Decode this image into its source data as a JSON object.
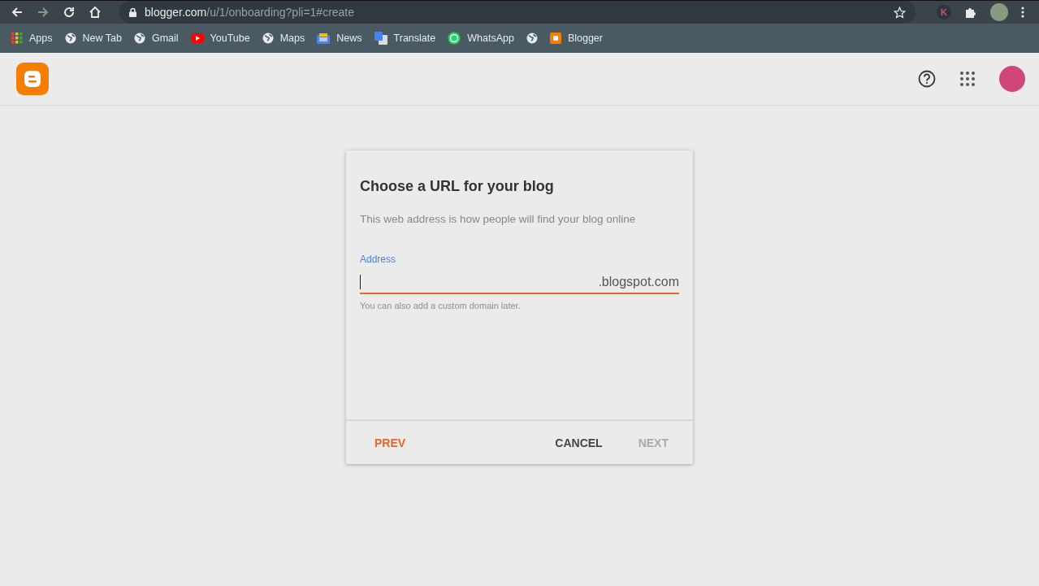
{
  "browser": {
    "url_host": "blogger.com",
    "url_path": "/u/1/onboarding?pli=1#create",
    "extension_letter": "K",
    "bookmarks": [
      {
        "kind": "apps",
        "label": "Apps"
      },
      {
        "kind": "globe",
        "label": "New Tab"
      },
      {
        "kind": "globe",
        "label": "Gmail"
      },
      {
        "kind": "youtube",
        "label": "YouTube"
      },
      {
        "kind": "globe",
        "label": "Maps"
      },
      {
        "kind": "news",
        "label": "News"
      },
      {
        "kind": "translate",
        "label": "Translate"
      },
      {
        "kind": "whatsapp",
        "label": "WhatsApp"
      },
      {
        "kind": "globe"
      },
      {
        "kind": "blogger",
        "label": "Blogger"
      }
    ]
  },
  "dialog": {
    "title": "Choose a URL for your blog",
    "subtitle": "This web address is how people will find your blog online",
    "field": {
      "label": "Address",
      "suffix": ".blogspot.com",
      "helper": "You can also add a custom domain later.",
      "focused": true
    },
    "buttons": [
      {
        "kind": "prev",
        "label": "PREV",
        "disabled": false
      },
      {
        "kind": "cancel",
        "label": "CANCEL",
        "disabled": false
      },
      {
        "kind": "next",
        "label": "NEXT",
        "disabled": true
      }
    ]
  }
}
